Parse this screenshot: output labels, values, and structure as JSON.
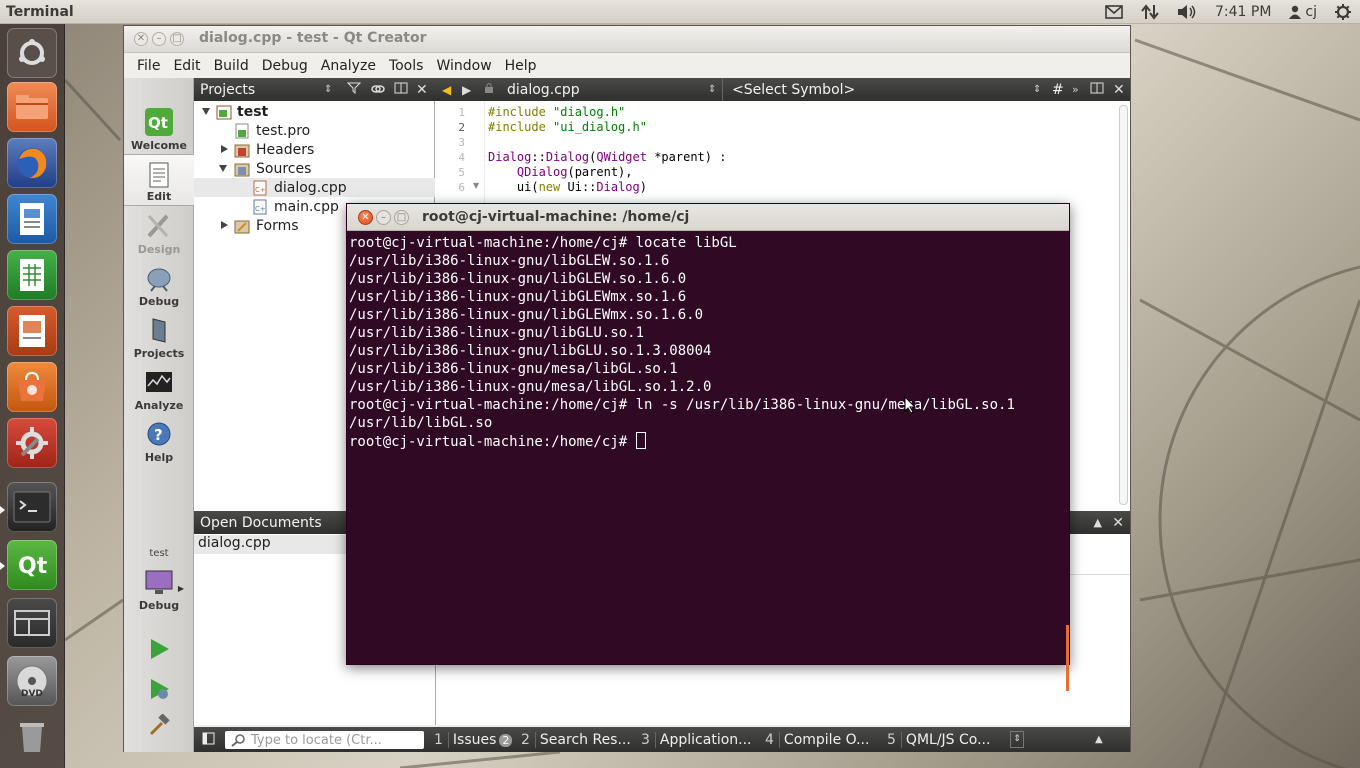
{
  "top_panel": {
    "app_title": "Terminal",
    "time": "7:41 PM",
    "user": "cj"
  },
  "launcher": {
    "items": [
      "Dash home",
      "Files",
      "Firefox",
      "LibreOffice Writer",
      "LibreOffice Calc",
      "LibreOffice Impress",
      "Ubuntu Software Center",
      "System Settings",
      "Terminal",
      "Qt Creator",
      "Workspace Switcher",
      "DVD",
      "Trash"
    ]
  },
  "qt_creator": {
    "window_title": "dialog.cpp - test - Qt Creator",
    "menu": [
      "File",
      "Edit",
      "Build",
      "Debug",
      "Analyze",
      "Tools",
      "Window",
      "Help"
    ],
    "modes": [
      "Welcome",
      "Edit",
      "Design",
      "Debug",
      "Projects",
      "Analyze",
      "Help"
    ],
    "kit": {
      "project": "test",
      "config": "Debug"
    },
    "projects_pane": {
      "title": "Projects",
      "tree": [
        {
          "label": "test",
          "level": 0
        },
        {
          "label": "test.pro",
          "level": 1
        },
        {
          "label": "Headers",
          "level": 1
        },
        {
          "label": "Sources",
          "level": 1
        },
        {
          "label": "dialog.cpp",
          "level": 2
        },
        {
          "label": "main.cpp",
          "level": 2
        },
        {
          "label": "Forms",
          "level": 1
        }
      ]
    },
    "editor": {
      "file_name": "dialog.cpp",
      "symbol": "<Select Symbol>",
      "hash": "#",
      "line_numbers": [
        "1",
        "2",
        "3",
        "4",
        "5",
        "6"
      ],
      "lines": [
        "#include \"dialog.h\"",
        "#include \"ui_dialog.h\"",
        "",
        "Dialog::Dialog(QWidget *parent) :",
        "    QDialog(parent),",
        "    ui(new Ui::Dialog)"
      ]
    },
    "open_documents": {
      "title": "Open Documents",
      "items": [
        "dialog.cpp"
      ]
    },
    "locator_placeholder": "Type to locate (Ctr...",
    "output_tabs": [
      {
        "num": "1",
        "label": "Issues",
        "badge": "2"
      },
      {
        "num": "2",
        "label": "Search Res..."
      },
      {
        "num": "3",
        "label": "Application..."
      },
      {
        "num": "4",
        "label": "Compile O..."
      },
      {
        "num": "5",
        "label": "QML/JS Co..."
      }
    ]
  },
  "terminal": {
    "title": "root@cj-virtual-machine: /home/cj",
    "lines": [
      "root@cj-virtual-machine:/home/cj# locate libGL",
      "/usr/lib/i386-linux-gnu/libGLEW.so.1.6",
      "/usr/lib/i386-linux-gnu/libGLEW.so.1.6.0",
      "/usr/lib/i386-linux-gnu/libGLEWmx.so.1.6",
      "/usr/lib/i386-linux-gnu/libGLEWmx.so.1.6.0",
      "/usr/lib/i386-linux-gnu/libGLU.so.1",
      "/usr/lib/i386-linux-gnu/libGLU.so.1.3.08004",
      "/usr/lib/i386-linux-gnu/mesa/libGL.so.1",
      "/usr/lib/i386-linux-gnu/mesa/libGL.so.1.2.0",
      "root@cj-virtual-machine:/home/cj# ln -s /usr/lib/i386-linux-gnu/mesa/libGL.so.1",
      "/usr/lib/libGL.so"
    ],
    "prompt": "root@cj-virtual-machine:/home/cj# ",
    "colors": {
      "background": "#300a24",
      "foreground": "#ffffff"
    }
  }
}
